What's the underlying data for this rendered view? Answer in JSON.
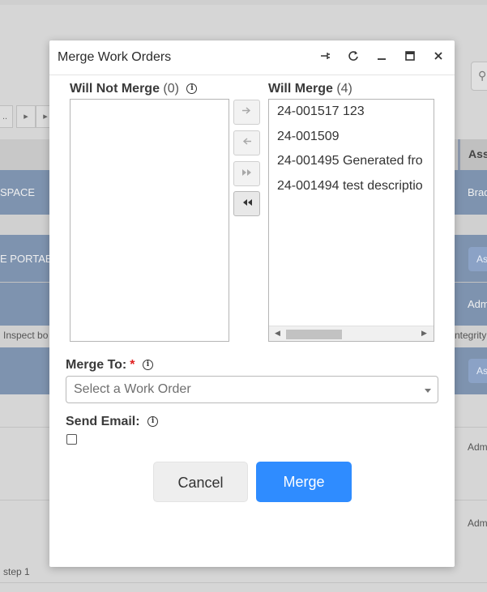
{
  "background": {
    "pager_labels": [
      "..",
      "▸",
      "▸"
    ],
    "header_cell": "Ass",
    "row_texts": {
      "row1_left": "SPACE",
      "row1_right": "Brad",
      "row2_left": "E PORTABL",
      "row2_btn": "As",
      "row3_right": "Adm",
      "row3_note_left": "Inspect bo",
      "row3_note_right": "ntegrity",
      "row4_btn": "As",
      "row5_right": "Adm",
      "row6_right": "Adm",
      "footer_left": "step 1"
    }
  },
  "modal": {
    "title": "Merge Work Orders",
    "header_icons": [
      "pin-icon",
      "refresh-icon",
      "minimize-icon",
      "maximize-icon",
      "close-icon"
    ],
    "will_not_merge": {
      "label": "Will Not Merge",
      "count": "(0)",
      "items": []
    },
    "will_merge": {
      "label": "Will Merge",
      "count": "(4)",
      "items": [
        "24-001517 123",
        "24-001509",
        "24-001495 Generated fro",
        "24-001494 test descriptio"
      ]
    },
    "move_buttons": {
      "move_right": "→",
      "move_left": "←",
      "move_all_right": "▸▸",
      "move_all_left": "◂◂"
    },
    "merge_to": {
      "label": "Merge To:",
      "required_mark": "*",
      "placeholder": "Select a Work Order"
    },
    "send_email": {
      "label": "Send Email:",
      "checked": false
    },
    "buttons": {
      "cancel": "Cancel",
      "merge": "Merge"
    },
    "colors": {
      "primary": "#2f8cff",
      "required": "#e02020"
    }
  }
}
